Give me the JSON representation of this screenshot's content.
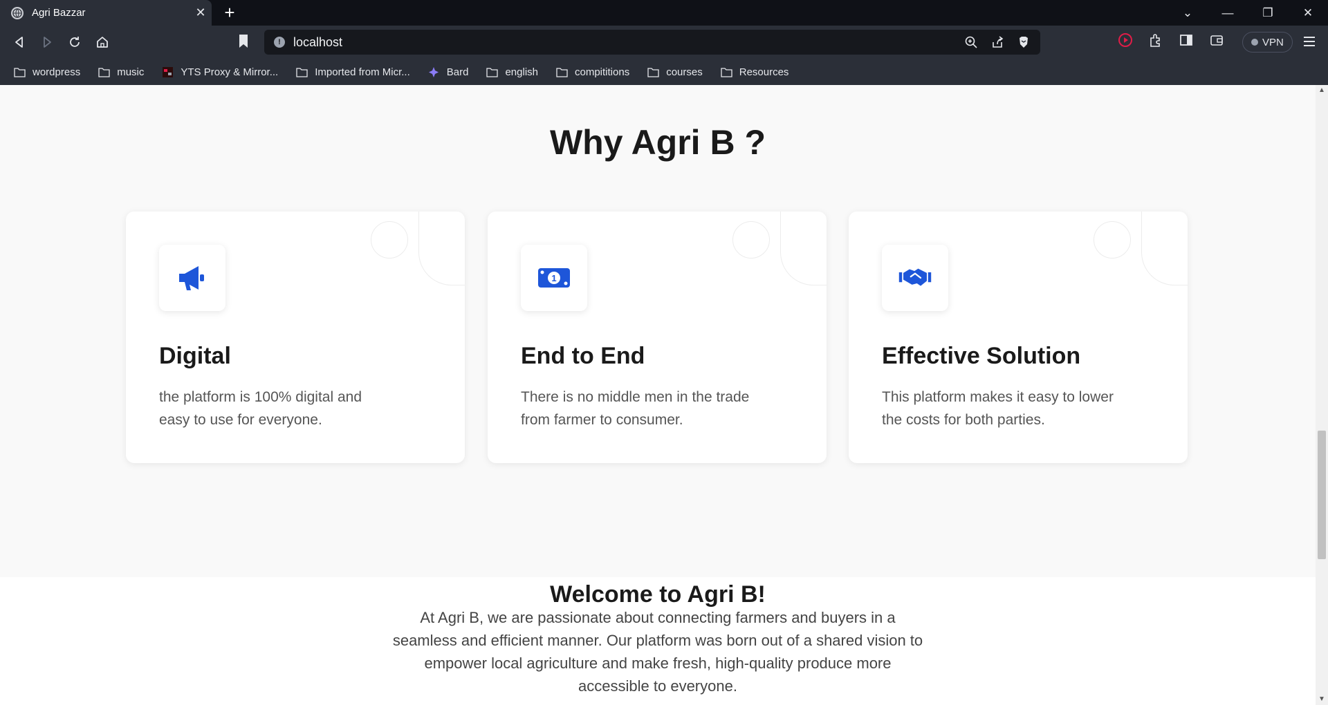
{
  "browser": {
    "tab_title": "Agri Bazzar",
    "tab_close": "✕",
    "new_tab": "+",
    "url": "localhost",
    "vpn_label": "VPN",
    "bookmarks": [
      {
        "label": "wordpress",
        "icon": "folder-icon"
      },
      {
        "label": "music",
        "icon": "folder-icon"
      },
      {
        "label": "YTS Proxy & Mirror...",
        "icon": "yts-favicon"
      },
      {
        "label": "Imported from Micr...",
        "icon": "folder-icon"
      },
      {
        "label": "Bard",
        "icon": "bard-sparkle-icon"
      },
      {
        "label": "english",
        "icon": "folder-icon"
      },
      {
        "label": "compititions",
        "icon": "folder-icon"
      },
      {
        "label": "courses",
        "icon": "folder-icon"
      },
      {
        "label": "Resources",
        "icon": "folder-icon"
      }
    ]
  },
  "page": {
    "why_title": "Why Agri B ?",
    "features": [
      {
        "icon": "megaphone-icon",
        "title": "Digital",
        "text": "the platform is 100% digital and easy to use for everyone."
      },
      {
        "icon": "money-bill-icon",
        "title": "End to End",
        "text": "There is no middle men in the trade from farmer to consumer."
      },
      {
        "icon": "handshake-icon",
        "title": "Effective Solution",
        "text": "This platform makes it easy to lower the costs for both parties."
      }
    ],
    "welcome_title": "Welcome to Agri B!",
    "welcome_text": "At Agri B, we are passionate about connecting farmers and buyers in a seamless and efficient manner. Our platform was born out of a shared vision to empower local agriculture and make fresh, high-quality produce more accessible to everyone."
  },
  "colors": {
    "accent": "#1e56d9",
    "chrome_bg": "#2b2f38",
    "titlebar_bg": "#0f1117"
  }
}
